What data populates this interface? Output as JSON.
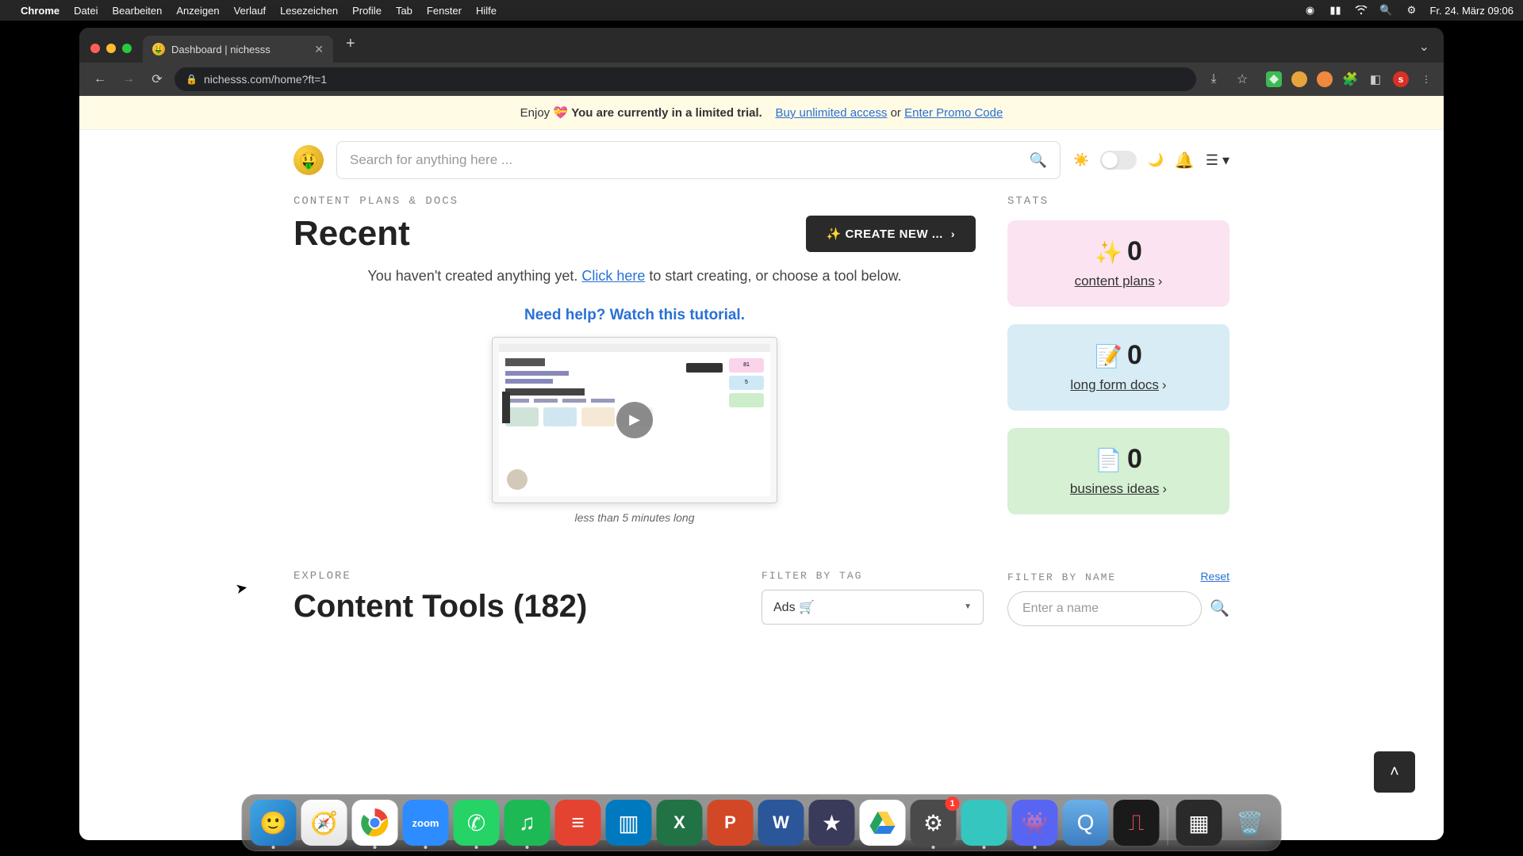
{
  "menubar": {
    "app": "Chrome",
    "items": [
      "Datei",
      "Bearbeiten",
      "Anzeigen",
      "Verlauf",
      "Lesezeichen",
      "Profile",
      "Tab",
      "Fenster",
      "Hilfe"
    ],
    "datetime": "Fr. 24. März  09:06"
  },
  "browser": {
    "tab_title": "Dashboard | nichesss",
    "url": "nichesss.com/home?ft=1",
    "avatar_letter": "s"
  },
  "banner": {
    "prefix": "Enjoy ",
    "bold": "You are currently in a limited trial.",
    "link1": "Buy unlimited access",
    "mid": " or ",
    "link2": "Enter Promo Code"
  },
  "search": {
    "placeholder": "Search for anything here ..."
  },
  "section_label": "CONTENT PLANS & DOCS",
  "recent": {
    "title": "Recent",
    "create_btn": "✨ CREATE NEW ...",
    "empty_pre": "You haven't created anything yet. ",
    "empty_link": "Click here",
    "empty_post": " to start creating, or choose a tool below.",
    "tutorial": "Need help? Watch this tutorial.",
    "video_caption": "less than 5 minutes long"
  },
  "stats": {
    "label": "STATS",
    "cards": [
      {
        "emoji": "✨",
        "value": "0",
        "label": "content plans"
      },
      {
        "emoji": "📝",
        "value": "0",
        "label": "long form docs"
      },
      {
        "emoji": "📄",
        "value": "0",
        "label": "business ideas"
      }
    ]
  },
  "explore": {
    "label": "EXPLORE",
    "title": "Content Tools (182)",
    "filter_tag_label": "FILTER BY TAG",
    "tag_value": "Ads 🛒",
    "filter_name_label": "FILTER BY NAME",
    "reset": "Reset",
    "name_placeholder": "Enter a name"
  },
  "dock": {
    "settings_badge": "1"
  }
}
